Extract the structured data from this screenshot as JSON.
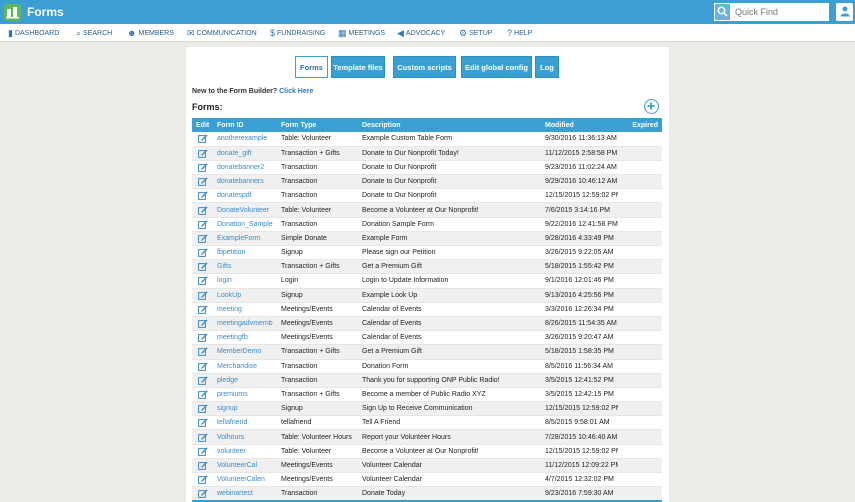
{
  "app": {
    "title": "Forms"
  },
  "quick_find": {
    "placeholder": "Quick Find"
  },
  "nav": [
    {
      "label": "DASHBOARD",
      "icon": "bar-chart-icon"
    },
    {
      "label": "SEARCH",
      "icon": "search-icon"
    },
    {
      "label": "MEMBERS",
      "icon": "users-icon"
    },
    {
      "label": "COMMUNICATION",
      "icon": "envelope-icon"
    },
    {
      "label": "FUNDRAISING",
      "icon": "dollar-icon"
    },
    {
      "label": "MEETINGS",
      "icon": "calendar-icon"
    },
    {
      "label": "ADVOCACY",
      "icon": "megaphone-icon"
    },
    {
      "label": "SETUP",
      "icon": "gear-icon"
    },
    {
      "label": "HELP",
      "icon": "question-icon"
    }
  ],
  "tabs": [
    {
      "label": "Forms",
      "active": true
    },
    {
      "label": "Template files",
      "active": false
    },
    {
      "label": "Custom scripts",
      "active": false
    },
    {
      "label": "Edit global config",
      "active": false
    },
    {
      "label": "Log",
      "active": false
    }
  ],
  "intro": {
    "text": "New to the Form Builder?",
    "link": "Click Here"
  },
  "forms_heading": "Forms:",
  "table": {
    "columns": [
      "Edit",
      "Form ID",
      "Form Type",
      "Description",
      "Modified",
      "Expired"
    ],
    "rows": [
      [
        "anotherexample",
        "Table: Volunteer",
        "Example Custom Table Form",
        "9/30/2016 11:36:13 AM",
        ""
      ],
      [
        "donate_gift",
        "Transaction + Gifts",
        "Donate to Our Nonprofit Today!",
        "11/12/2015 2:58:58 PM",
        ""
      ],
      [
        "donatebanner2",
        "Transaction",
        "Donate to Our Nonprofit",
        "9/23/2016 11:02:24 AM",
        ""
      ],
      [
        "donatebanners",
        "Transaction",
        "Donate to Our Nonprofit",
        "9/29/2016 10:46:12 AM",
        ""
      ],
      [
        "donatespdf",
        "Transaction",
        "Donate to Our Nonprofit",
        "12/15/2015 12:59:02 PM",
        ""
      ],
      [
        "DonateVolunteer",
        "Table: Volunteer",
        "Become a Volunteer at Our Nonprofit!",
        "7/6/2015 3:14:16 PM",
        ""
      ],
      [
        "Donation_Sample",
        "Transaction",
        "Donation Sample Form",
        "9/22/2016 12:41:58 PM",
        ""
      ],
      [
        "ExampleForm",
        "Simple Donate",
        "Example Form",
        "9/28/2016 4:33:49 PM",
        ""
      ],
      [
        "fbpetition",
        "Signup",
        "Please sign our Petition",
        "3/26/2015 9:22:05 AM",
        ""
      ],
      [
        "Gifts",
        "Transaction + Gifts",
        "Get a Premium Gift",
        "5/18/2015 1:55:42 PM",
        ""
      ],
      [
        "login",
        "Login",
        "Login to Update Information",
        "9/1/2016 12:01:46 PM",
        ""
      ],
      [
        "LookUp",
        "Signup",
        "Example Look Up",
        "9/13/2016 4:25:56 PM",
        ""
      ],
      [
        "meeting",
        "Meetings/Events",
        "Calendar of Events",
        "3/3/2016 12:26:34 PM",
        ""
      ],
      [
        "meetingadvmemb",
        "Meetings/Events",
        "Calendar of Events",
        "8/26/2015 11:54:35 AM",
        ""
      ],
      [
        "meetingfb",
        "Meetings/Events",
        "Calendar of Events",
        "3/26/2015 9:20:47 AM",
        ""
      ],
      [
        "MemberDemo",
        "Transaction + Gifts",
        "Get a Premium Gift",
        "5/18/2015 1:58:35 PM",
        ""
      ],
      [
        "Merchandise",
        "Transaction",
        "Donation Form",
        "8/5/2016 11:56:34 AM",
        ""
      ],
      [
        "pledge",
        "Transaction",
        "Thank you for supporting ONP Public Radio!",
        "3/5/2015 12:41:52 PM",
        ""
      ],
      [
        "premiums",
        "Transaction + Gifts",
        "Become a member of Public Radio XYZ",
        "3/5/2015 12:42:15 PM",
        ""
      ],
      [
        "signup",
        "Signup",
        "Sign Up to Receive Communication",
        "12/15/2015 12:59:02 PM",
        ""
      ],
      [
        "tellafriend",
        "tellafriend",
        "Tell A Friend",
        "8/5/2015 9:58:01 AM",
        ""
      ],
      [
        "Volhours",
        "Table: Volunteer Hours",
        "Report your Volunteer Hours",
        "7/28/2015 10:46:40 AM",
        ""
      ],
      [
        "volunteer",
        "Table: Volunteer",
        "Become a Volunteer at Our Nonprofit!",
        "12/15/2015 12:59:02 PM",
        ""
      ],
      [
        "VolunteerCal",
        "Meetings/Events",
        "Volunteer Calendar",
        "11/12/2015 12:09:22 PM",
        ""
      ],
      [
        "VolunteerCalen",
        "Meetings/Events",
        "Volunteer Calendar",
        "4/7/2015 12:32:02 PM",
        ""
      ],
      [
        "webinartest",
        "Transaction",
        "Donate Today",
        "9/23/2016 7:59:30 AM",
        ""
      ]
    ]
  }
}
